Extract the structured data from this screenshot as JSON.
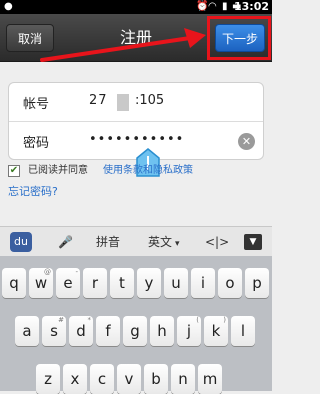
{
  "status_bar": {
    "time": "13:02",
    "icons": [
      "app-icon",
      "wifi-icon",
      "signal-icon",
      "battery-icon"
    ]
  },
  "titlebar": {
    "cancel_label": "取消",
    "title": "注册",
    "next_label": "下一步"
  },
  "form": {
    "account_label": "帐号",
    "account_value_start": "27",
    "account_value_end": ":105",
    "password_label": "密码",
    "password_value": "•••••••••••"
  },
  "agreement": {
    "checked": true,
    "text": "已阅读并同意",
    "link": "使用条款和隐私政策"
  },
  "forgot_password": "忘记密码?",
  "ime_bar": {
    "pinyin": "拼音",
    "english": "英文"
  },
  "keyboard": {
    "row1": [
      {
        "key": "q",
        "sub": ""
      },
      {
        "key": "w",
        "sub": "@"
      },
      {
        "key": "e",
        "sub": "-"
      },
      {
        "key": "r",
        "sub": ""
      },
      {
        "key": "t",
        "sub": ""
      },
      {
        "key": "y",
        "sub": ""
      },
      {
        "key": "u",
        "sub": ""
      },
      {
        "key": "i",
        "sub": ""
      },
      {
        "key": "o",
        "sub": ""
      },
      {
        "key": "p",
        "sub": ""
      }
    ],
    "row2": [
      {
        "key": "a",
        "sub": ""
      },
      {
        "key": "s",
        "sub": "#"
      },
      {
        "key": "d",
        "sub": "*"
      },
      {
        "key": "f",
        "sub": ""
      },
      {
        "key": "g",
        "sub": ""
      },
      {
        "key": "h",
        "sub": ""
      },
      {
        "key": "j",
        "sub": "("
      },
      {
        "key": "k",
        "sub": ")"
      },
      {
        "key": "l",
        "sub": ""
      }
    ],
    "row3": [
      {
        "key": "z",
        "sub": ""
      },
      {
        "key": "x",
        "sub": ""
      },
      {
        "key": "c",
        "sub": ""
      },
      {
        "key": "v",
        "sub": ""
      },
      {
        "key": "b",
        "sub": ""
      },
      {
        "key": "n",
        "sub": ""
      },
      {
        "key": "m",
        "sub": ""
      }
    ]
  },
  "colors": {
    "titlebar": "#333333",
    "next_button": "#2b74d8",
    "highlight": "#e8141b",
    "link": "#2a6fc9"
  }
}
